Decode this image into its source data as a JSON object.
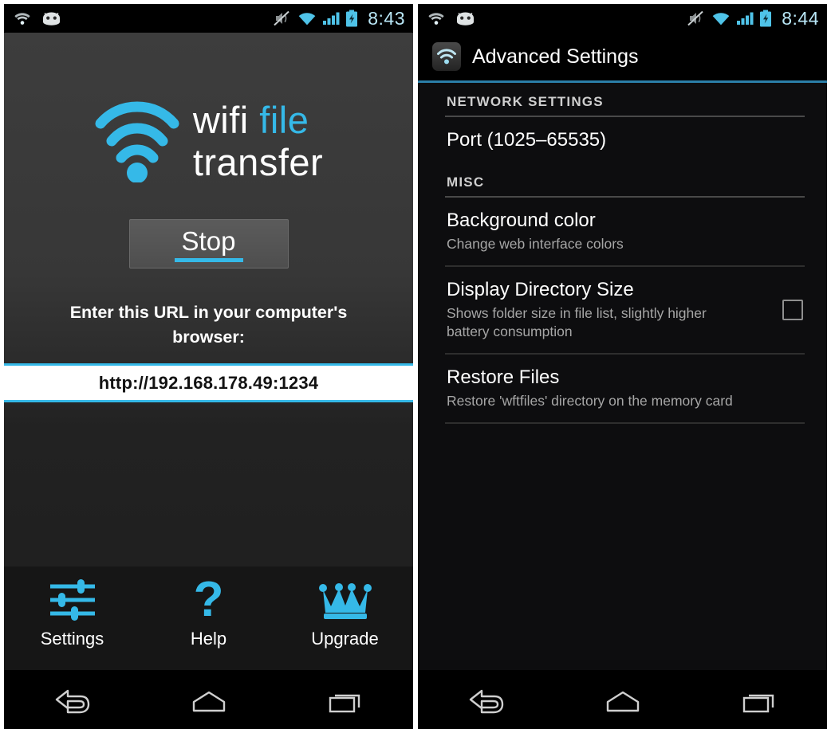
{
  "left_screen": {
    "status_bar": {
      "clock": "8:43",
      "left_icons": [
        "wifi-icon",
        "android-bean-icon"
      ],
      "right_icons": [
        "volume-muted-icon",
        "wifi-signal-icon",
        "cellular-signal-icon",
        "battery-charging-icon"
      ]
    },
    "logo": {
      "icon": "wifi-logo-icon",
      "word1": "wifi",
      "word2": "file",
      "word3": "transfer",
      "accent_color": "#35b9e8"
    },
    "stop_button": {
      "label": "Stop"
    },
    "url_hint": "Enter this URL in your computer's browser:",
    "url_value": "http://192.168.178.49:1234",
    "actions": [
      {
        "label": "Settings",
        "icon": "sliders-icon"
      },
      {
        "label": "Help",
        "icon": "question-mark-icon"
      },
      {
        "label": "Upgrade",
        "icon": "crown-icon"
      }
    ],
    "nav_bar": [
      {
        "name": "back",
        "icon": "back-arrow-icon"
      },
      {
        "name": "home",
        "icon": "home-icon"
      },
      {
        "name": "recents",
        "icon": "recents-icon"
      }
    ]
  },
  "right_screen": {
    "status_bar": {
      "clock": "8:44",
      "left_icons": [
        "wifi-icon",
        "android-bean-icon"
      ],
      "right_icons": [
        "volume-muted-icon",
        "wifi-signal-icon",
        "cellular-signal-icon",
        "battery-charging-icon"
      ]
    },
    "header": {
      "icon": "app-wifi-icon",
      "title": "Advanced Settings",
      "accent_color": "#2b7fa8"
    },
    "sections": [
      {
        "header": "NETWORK SETTINGS",
        "items": [
          {
            "title": "Port (1025–65535)",
            "subtitle": "",
            "checkbox": false,
            "has_checkbox": false
          }
        ]
      },
      {
        "header": "MISC",
        "items": [
          {
            "title": "Background color",
            "subtitle": "Change web interface colors",
            "checkbox": false,
            "has_checkbox": false
          },
          {
            "title": "Display Directory Size",
            "subtitle": "Shows folder size in file list, slightly higher battery consumption",
            "checkbox": false,
            "has_checkbox": true
          },
          {
            "title": "Restore Files",
            "subtitle": "Restore 'wftfiles' directory on the memory card",
            "checkbox": false,
            "has_checkbox": false
          }
        ]
      }
    ],
    "nav_bar": [
      {
        "name": "back",
        "icon": "back-arrow-icon"
      },
      {
        "name": "home",
        "icon": "home-icon"
      },
      {
        "name": "recents",
        "icon": "recents-icon"
      }
    ]
  }
}
